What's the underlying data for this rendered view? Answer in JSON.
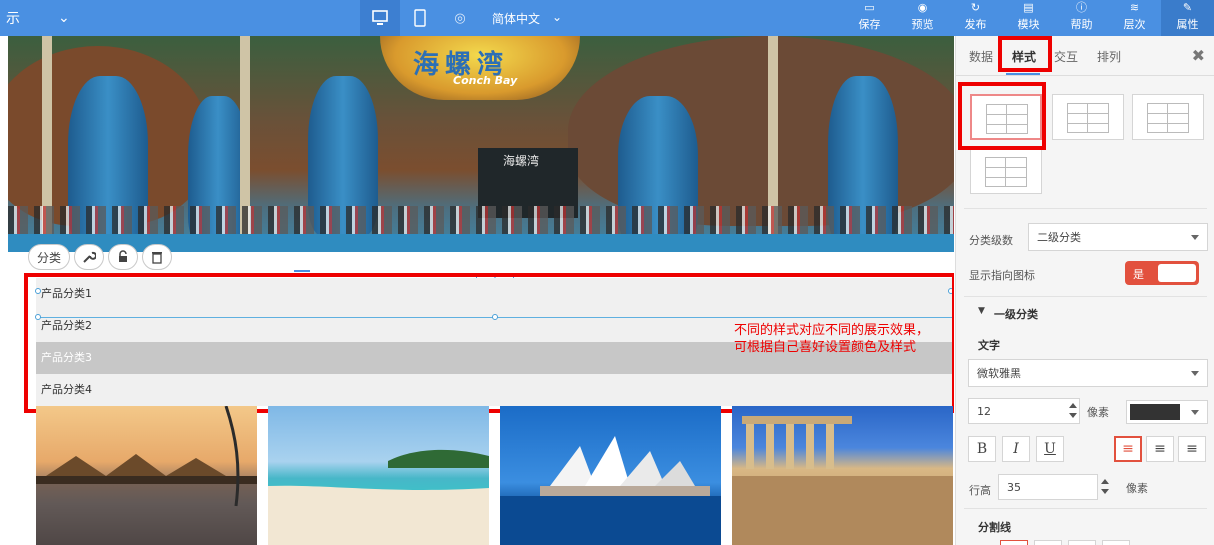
{
  "toolbar": {
    "left_label": "示",
    "language": "简体中文",
    "buttons": [
      {
        "icon": "save-icon",
        "label": "保存"
      },
      {
        "icon": "preview-icon",
        "label": "预览"
      },
      {
        "icon": "publish-icon",
        "label": "发布"
      },
      {
        "icon": "template-icon",
        "label": "模块"
      },
      {
        "icon": "help-icon",
        "label": "帮助"
      },
      {
        "icon": "layers-icon",
        "label": "层次"
      },
      {
        "icon": "properties-icon",
        "label": "属性"
      }
    ],
    "active_button": "属性",
    "brand_color": "#4a90e2"
  },
  "banner": {
    "sign_text": "海螺湾",
    "sign_subtext": "Conch Bay",
    "door_text": "海螺湾"
  },
  "element_tools": {
    "category_label": "分类",
    "icons": [
      "wrench-icon",
      "unlock-icon",
      "trash-icon"
    ]
  },
  "categories": [
    {
      "label": "产品分类1",
      "highlighted": false
    },
    {
      "label": "产品分类2",
      "highlighted": false
    },
    {
      "label": "产品分类3",
      "highlighted": true
    },
    {
      "label": "产品分类4",
      "highlighted": false
    }
  ],
  "annotation": {
    "text": "不同的样式对应不同的展示效果，可根据自己喜好设置颜色及样式",
    "color": "#ee0000"
  },
  "panel": {
    "tabs": [
      "数据",
      "样式",
      "交互",
      "排列"
    ],
    "active_tab": "样式",
    "close_symbol": "✖",
    "category_level_label": "分类级数",
    "category_level_value": "二级分类",
    "show_icon_label": "显示指向图标",
    "show_icon_value": "是",
    "level1_section": "一级分类",
    "text_section": "文字",
    "font_value": "微软雅黑",
    "font_size_value": "12",
    "font_size_unit": "像素",
    "color_swatch": "#333333",
    "format_buttons": [
      "B",
      "I",
      "U"
    ],
    "align_icons": [
      "align-left-icon",
      "align-center-icon",
      "align-right-icon"
    ],
    "line_height_label": "行高",
    "line_height_value": "35",
    "line_height_unit": "像素",
    "divider_section": "分割线",
    "toggle_color": "#e2513e"
  }
}
